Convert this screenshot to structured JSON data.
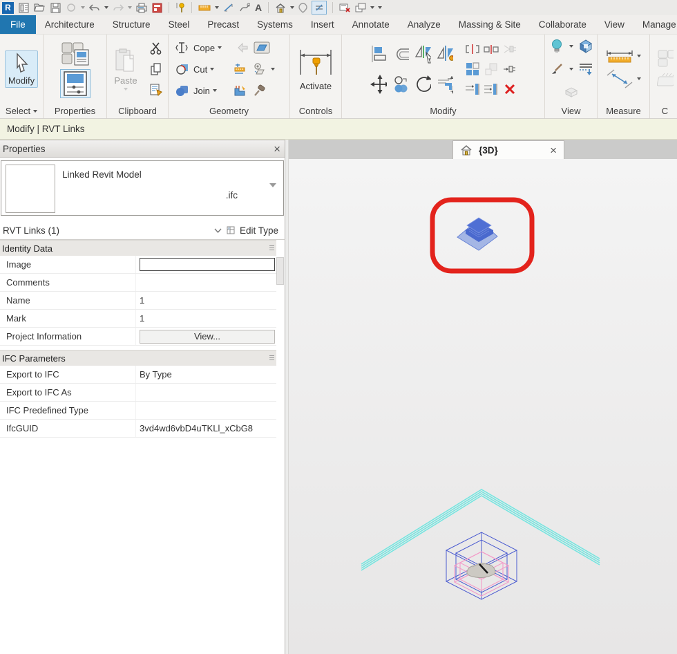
{
  "glyphs": {
    "revit_logo": "R",
    "text_tool": "A",
    "close": "×"
  },
  "tabs": {
    "file": "File",
    "items": [
      "Architecture",
      "Structure",
      "Steel",
      "Precast",
      "Systems",
      "Insert",
      "Annotate",
      "Analyze",
      "Massing & Site",
      "Collaborate",
      "View",
      "Manage"
    ]
  },
  "ribbon": {
    "select_panel": {
      "button": "Modify",
      "label": "Select"
    },
    "properties_panel": {
      "label": "Properties"
    },
    "clipboard_panel": {
      "paste": "Paste",
      "label": "Clipboard"
    },
    "geometry_panel": {
      "cope": "Cope",
      "cut": "Cut",
      "join": "Join",
      "label": "Geometry"
    },
    "controls_panel": {
      "activate": "Activate",
      "label": "Controls"
    },
    "modify_panel": {
      "label": "Modify"
    },
    "view_panel": {
      "label": "View"
    },
    "measure_panel": {
      "label": "Measure"
    },
    "create_panel": {
      "label": "C"
    }
  },
  "option_bar": {
    "text": "Modify | RVT Links"
  },
  "properties": {
    "header": "Properties",
    "type_selector": {
      "name": "Linked Revit Model",
      "type": ".ifc"
    },
    "filter": {
      "label": "RVT Links (1)",
      "edit_type": "Edit Type"
    },
    "identity": {
      "title": "Identity Data",
      "image_label": "Image",
      "comments_label": "Comments",
      "name_label": "Name",
      "name_value": "1",
      "mark_label": "Mark",
      "mark_value": "1",
      "project_info_label": "Project Information",
      "view_button": "View..."
    },
    "ifc": {
      "title": "IFC Parameters",
      "rows": [
        [
          "Export to IFC",
          "By Type"
        ],
        [
          "Export to IFC As",
          ""
        ],
        [
          "IFC Predefined Type",
          ""
        ],
        [
          "IfcGUID",
          "3vd4wd6vbD4uTKLl_xCbG8"
        ]
      ]
    }
  },
  "view_tab": {
    "title": "{3D}"
  },
  "colors": {
    "file_tab_blue": "#2076b0",
    "highlight_red": "#e3231c",
    "selection_blue": "#4a6cd0",
    "cyan_line": "#72e5e0",
    "pink_line": "#f49ac8"
  }
}
